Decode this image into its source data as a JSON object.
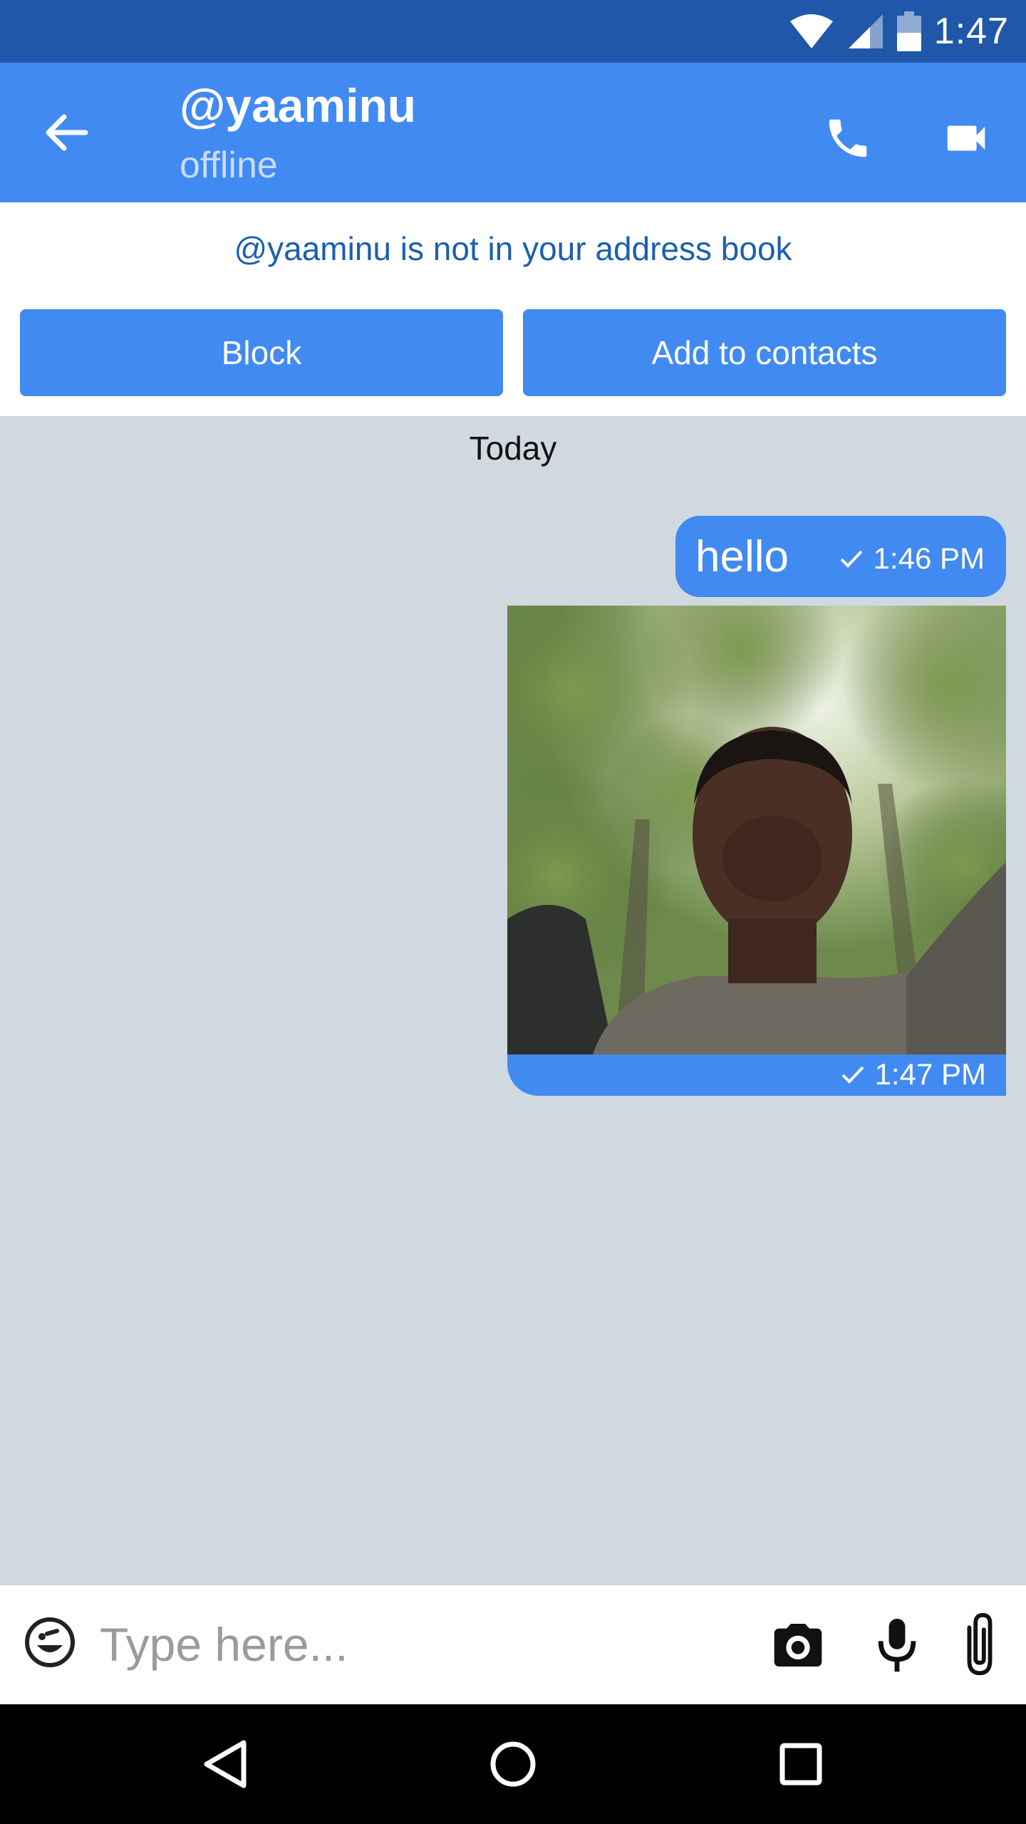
{
  "status_bar": {
    "time": "1:47"
  },
  "header": {
    "contact_name": "@yaaminu",
    "contact_status": "offline"
  },
  "notice": {
    "text": "@yaaminu is not in your address book",
    "block_label": "Block",
    "add_label": "Add to contacts"
  },
  "chat": {
    "date_separator": "Today",
    "messages": [
      {
        "type": "text",
        "text": "hello",
        "time": "1:46 PM",
        "status": "sent"
      },
      {
        "type": "image",
        "time": "1:47 PM",
        "status": "sent"
      }
    ]
  },
  "composer": {
    "placeholder": "Type here..."
  },
  "colors": {
    "status_bar": "#2157a8",
    "primary": "#418af2",
    "chat_background": "#d1d9e0",
    "notice_text": "#1b5fb0"
  },
  "icons": [
    "wifi-icon",
    "signal-icon",
    "battery-icon",
    "back-arrow-icon",
    "phone-icon",
    "video-camera-icon",
    "check-icon",
    "emoji-icon",
    "camera-icon",
    "microphone-icon",
    "paperclip-icon",
    "nav-back-icon",
    "nav-home-icon",
    "nav-recents-icon"
  ]
}
